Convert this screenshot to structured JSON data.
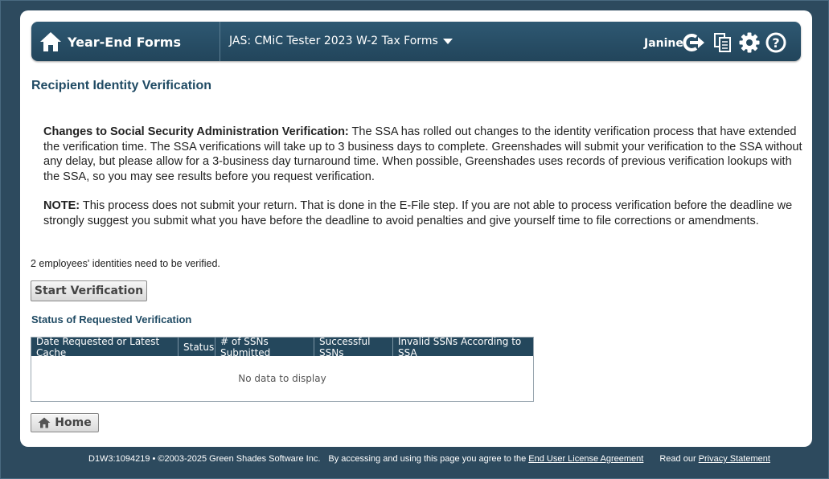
{
  "header": {
    "app_title": "Year-End Forms",
    "form_selector": "JAS: CMiC Tester 2023 W-2 Tax Forms",
    "user_name": "Janine",
    "icons": [
      "home-icon",
      "logout-icon",
      "copy-icon",
      "gear-icon",
      "help-icon"
    ]
  },
  "page": {
    "title": "Recipient Identity Verification",
    "notice1_bold": "Changes to Social Security Administration Verification:",
    "notice1_text": " The SSA has rolled out changes to the identity verification process that have extended the verification time. The SSA verifications will take up to 3 business days to complete. Greenshades will submit your verification to the SSA without any delay, but please allow for a 3-business day turnaround time. When possible, Greenshades uses records of previous verification lookups with the SSA, so you may see results before you request verification.",
    "notice2_bold": "NOTE:",
    "notice2_text": " This process does not submit your return. That is done in the E-File step. If you are not able to process verification before the deadline we strongly suggest you submit what you have before the deadline to avoid penalties and give yourself time to file corrections or amendments.",
    "need_verify": "2 employees' identities need to be verified.",
    "start_button": "Start Verification",
    "status_heading": "Status of Requested Verification",
    "home_button": "Home"
  },
  "table": {
    "columns": [
      "Date Requested or Latest Cache",
      "Status",
      "# of SSNs Submitted",
      "Successful SSNs",
      "Invalid SSNs According to SSA"
    ],
    "empty_text": "No data to display"
  },
  "footer": {
    "build": "D1W3:1094219",
    "copyright": " • ©2003-2025 Green Shades Software Inc.",
    "agree_text": "By accessing and using this page you agree to the ",
    "eula_link": "End User License Agreement",
    "read_text": "Read our ",
    "privacy_link": "Privacy Statement"
  },
  "colors": {
    "background": "#2d4a5e",
    "header": "#24475c",
    "heading_text": "#1f4a63"
  }
}
